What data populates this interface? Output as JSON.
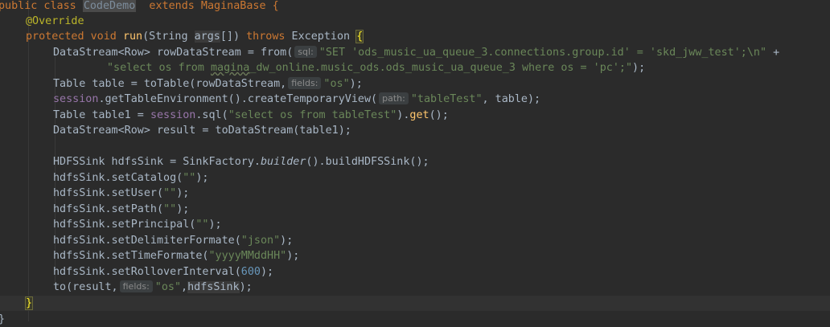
{
  "code": {
    "l1": {
      "t1": "public class ",
      "cls": "CodeDemo",
      "t2": "  extends MaginaBase {"
    },
    "l2": {
      "ann": "@Override"
    },
    "l3": {
      "kw1": "protected void ",
      "fn": "run",
      "t1": "(String ",
      "param": "args",
      "t2": "[]) ",
      "kw2": "throws",
      "t3": " Exception ",
      "brace": "{"
    },
    "l4": {
      "t1": "DataStream<Row> rowDataStream = from(",
      "hint": "sql:",
      "str": "\"SET 'ods_music_ua_queue_3.connections.group.id' = 'skd_jww_test';\\n\"",
      "t2": " +"
    },
    "l5": {
      "s1": "\"select os from ",
      "sq": "magina",
      "s2": "_dw_online.music_ods.ods_music_ua_queue_3 where os = 'pc';\"",
      "t1": ");"
    },
    "l6": {
      "t1": "Table table = toTable(rowDataStream,",
      "hint": "fields:",
      "str": "\"os\"",
      "t2": ");"
    },
    "l7": {
      "field": "session",
      "t1": ".getTableEnvironment().createTemporaryView(",
      "hint": "path:",
      "str": "\"tableTest\"",
      "t2": ", table);"
    },
    "l8": {
      "t1": "Table table1 = ",
      "field": "session",
      "t2": ".sql(",
      "str": "\"select os from tableTest\"",
      "t3": ").",
      "fn": "get",
      "t4": "();"
    },
    "l9": {
      "t1": "DataStream<Row> result = toDataStream(table1);"
    },
    "l11": {
      "t1": "HDFSSink hdfsSink = SinkFactory.",
      "it": "builder",
      "t2": "().buildHDFSSink();"
    },
    "l12": {
      "t1": "hdfsSink.setCatalog(",
      "str": "\"\"",
      "t2": ");"
    },
    "l13": {
      "t1": "hdfsSink.setUser(",
      "str": "\"\"",
      "t2": ");"
    },
    "l14": {
      "t1": "hdfsSink.setPath(",
      "str": "\"\"",
      "t2": ");"
    },
    "l15": {
      "t1": "hdfsSink.setPrincipal(",
      "str": "\"\"",
      "t2": ");"
    },
    "l16": {
      "t1": "hdfsSink.setDelimiterFormate(",
      "str": "\"json\"",
      "t2": ");"
    },
    "l17": {
      "t1": "hdfsSink.setTimeFormate(",
      "str": "\"yyyyMMddHH\"",
      "t2": ");"
    },
    "l18": {
      "t1": "hdfsSink.setRolloverInterval(",
      "num": "600",
      "t2": ");"
    },
    "l19": {
      "t1": "to(result,",
      "hint": "fields:",
      "str": "\"os\"",
      "t2": ",",
      "hl": "hdfsSink",
      "t3": ");"
    },
    "l20": {
      "brace": "}"
    },
    "l21": {
      "brace": "}"
    }
  },
  "colors": {
    "background": "#2b2b2b",
    "keyword": "#cc7832",
    "annotation": "#bbb529",
    "method": "#ffc66d",
    "string": "#6a8759",
    "number": "#6897bb",
    "field": "#9876aa"
  }
}
